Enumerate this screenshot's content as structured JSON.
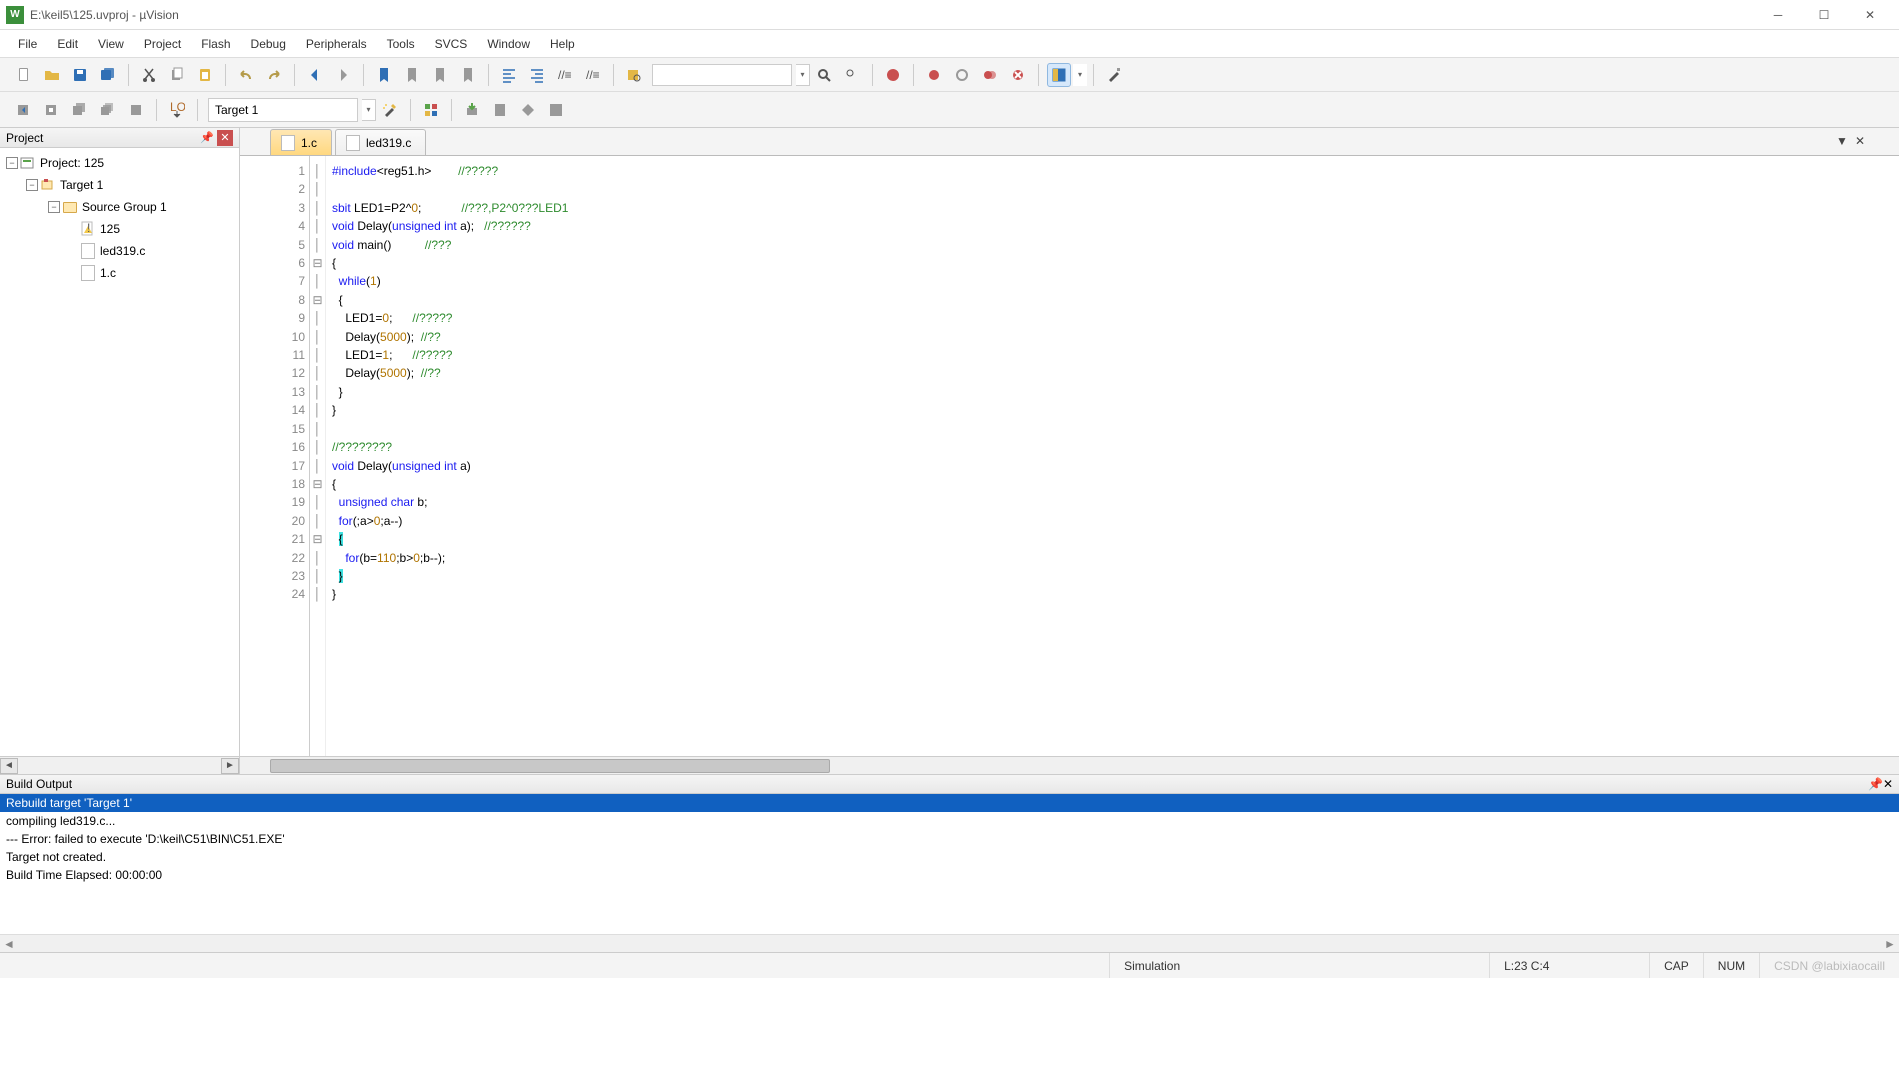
{
  "title": "E:\\keil5\\125.uvproj - µVision",
  "menu": [
    "File",
    "Edit",
    "View",
    "Project",
    "Flash",
    "Debug",
    "Peripherals",
    "Tools",
    "SVCS",
    "Window",
    "Help"
  ],
  "target_selector": "Target 1",
  "project": {
    "panel_title": "Project",
    "root": "Project: 125",
    "target": "Target 1",
    "group": "Source Group 1",
    "files": [
      "125",
      "led319.c",
      "1.c"
    ]
  },
  "tabs": [
    {
      "label": "1.c",
      "active": false
    },
    {
      "label": "led319.c",
      "active": true
    }
  ],
  "code": {
    "lines": [
      {
        "n": 1,
        "h": "<span class='kw'>#include</span>&lt;reg51.h&gt;        <span class='com'>//?????</span>"
      },
      {
        "n": 2,
        "h": ""
      },
      {
        "n": 3,
        "h": "<span class='kw'>sbit</span> LED1=P2^<span class='num'>0</span>;            <span class='com'>//???,P2^0???LED1</span>"
      },
      {
        "n": 4,
        "h": "<span class='kw'>void</span> Delay(<span class='kw'>unsigned</span> <span class='kw'>int</span> a);   <span class='com'>//??????</span>"
      },
      {
        "n": 5,
        "h": "<span class='kw'>void</span> main()          <span class='com'>//???</span>"
      },
      {
        "n": 6,
        "h": "{",
        "fold": "⊟"
      },
      {
        "n": 7,
        "h": "  <span class='kw'>while</span>(<span class='num'>1</span>)"
      },
      {
        "n": 8,
        "h": "  {",
        "fold": "⊟"
      },
      {
        "n": 9,
        "h": "    LED1=<span class='num'>0</span>;      <span class='com'>//?????</span>"
      },
      {
        "n": 10,
        "h": "    Delay(<span class='num'>5000</span>);  <span class='com'>//??</span>"
      },
      {
        "n": 11,
        "h": "    LED1=<span class='num'>1</span>;      <span class='com'>//?????</span>"
      },
      {
        "n": 12,
        "h": "    Delay(<span class='num'>5000</span>);  <span class='com'>//??</span>"
      },
      {
        "n": 13,
        "h": "  }"
      },
      {
        "n": 14,
        "h": "}"
      },
      {
        "n": 15,
        "h": ""
      },
      {
        "n": 16,
        "h": "<span class='com'>//????????</span>"
      },
      {
        "n": 17,
        "h": "<span class='kw'>void</span> Delay(<span class='kw'>unsigned</span> <span class='kw'>int</span> a)"
      },
      {
        "n": 18,
        "h": "{",
        "fold": "⊟"
      },
      {
        "n": 19,
        "h": "  <span class='kw'>unsigned</span> <span class='kw'>char</span> b;"
      },
      {
        "n": 20,
        "h": "  <span class='kw'>for</span>(;a&gt;<span class='num'>0</span>;a--)"
      },
      {
        "n": 21,
        "h": "  <span class='hl'>{</span>",
        "fold": "⊟"
      },
      {
        "n": 22,
        "h": "    <span class='kw'>for</span>(b=<span class='num'>110</span>;b&gt;<span class='num'>0</span>;b--);"
      },
      {
        "n": 23,
        "h": "  <span class='hl'>}</span>"
      },
      {
        "n": 24,
        "h": "}"
      }
    ]
  },
  "build_output": {
    "title": "Build Output",
    "lines": [
      {
        "sel": true,
        "t": "Rebuild target 'Target 1'"
      },
      {
        "sel": false,
        "t": "compiling led319.c..."
      },
      {
        "sel": false,
        "t": "--- Error: failed to execute 'D:\\keil\\C51\\BIN\\C51.EXE'"
      },
      {
        "sel": false,
        "t": "Target not created."
      },
      {
        "sel": false,
        "t": "Build Time Elapsed:  00:00:00"
      }
    ]
  },
  "status": {
    "sim": "Simulation",
    "pos": "L:23 C:4",
    "cap": "CAP",
    "num": "NUM",
    "watermark": "CSDN @labixiaocaill"
  }
}
